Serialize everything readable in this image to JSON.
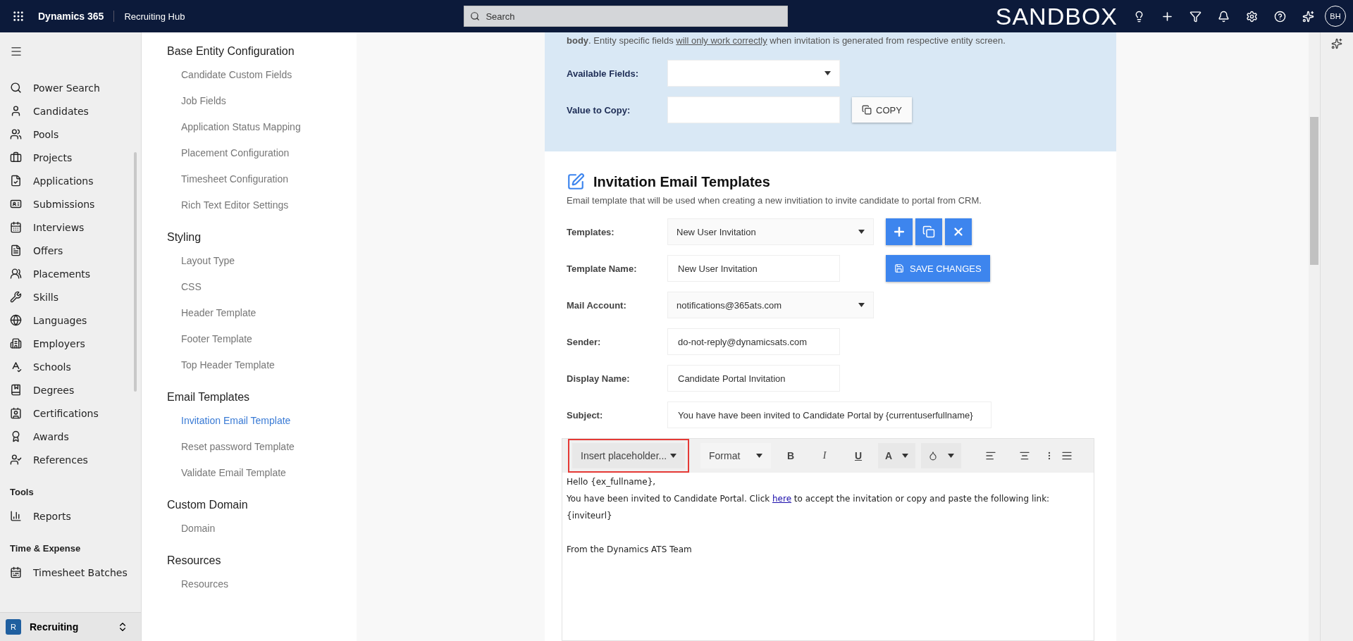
{
  "topbar": {
    "app_name": "Dynamics 365",
    "area_name": "Recruiting Hub",
    "search_placeholder": "Search",
    "environment": "SANDBOX",
    "avatar": "BH"
  },
  "nav": {
    "items": [
      {
        "label": "Power Search",
        "selected": false
      },
      {
        "label": "Candidates",
        "selected": false
      },
      {
        "label": "Pools",
        "selected": false
      },
      {
        "label": "Projects",
        "selected": false
      },
      {
        "label": "Applications",
        "selected": false
      },
      {
        "label": "Submissions",
        "selected": false
      },
      {
        "label": "Interviews",
        "selected": false
      },
      {
        "label": "Offers",
        "selected": false
      },
      {
        "label": "Placements",
        "selected": false
      },
      {
        "label": "Skills",
        "selected": false
      },
      {
        "label": "Languages",
        "selected": false
      },
      {
        "label": "Employers",
        "selected": false
      },
      {
        "label": "Schools",
        "selected": false
      },
      {
        "label": "Degrees",
        "selected": false
      },
      {
        "label": "Certifications",
        "selected": false
      },
      {
        "label": "Awards",
        "selected": false
      },
      {
        "label": "References",
        "selected": false
      }
    ],
    "groups": [
      {
        "title": "Tools",
        "items": [
          {
            "label": "Reports",
            "selected": false
          }
        ]
      },
      {
        "title": "Time & Expense",
        "items": [
          {
            "label": "Timesheet Batches",
            "selected": false
          }
        ]
      }
    ],
    "area_switcher": {
      "badge": "R",
      "label": "Recruiting"
    }
  },
  "settings_menu": [
    {
      "title": "Base Entity Configuration",
      "items": [
        {
          "label": "Candidate Custom Fields",
          "selected": false
        },
        {
          "label": "Job Fields",
          "selected": false
        },
        {
          "label": "Application Status Mapping",
          "selected": false
        },
        {
          "label": "Placement Configuration",
          "selected": false
        },
        {
          "label": "Timesheet Configuration",
          "selected": false
        },
        {
          "label": "Rich Text Editor Settings",
          "selected": false
        }
      ]
    },
    {
      "title": "Styling",
      "items": [
        {
          "label": "Layout Type",
          "selected": false
        },
        {
          "label": "CSS",
          "selected": false
        },
        {
          "label": "Header Template",
          "selected": false
        },
        {
          "label": "Footer Template",
          "selected": false
        },
        {
          "label": "Top Header Template",
          "selected": false
        }
      ]
    },
    {
      "title": "Email Templates",
      "items": [
        {
          "label": "Invitation Email Template",
          "selected": true
        },
        {
          "label": "Reset password Template",
          "selected": false
        },
        {
          "label": "Validate Email Template",
          "selected": false
        }
      ]
    },
    {
      "title": "Custom Domain",
      "items": [
        {
          "label": "Domain",
          "selected": false
        }
      ]
    },
    {
      "title": "Resources",
      "items": [
        {
          "label": "Resources",
          "selected": false
        }
      ]
    }
  ],
  "field_helper": {
    "note_start": "**body**. Entity specific fields ",
    "note_link": "will only work correctly",
    "note_end": " when invitation is generated from respective entity screen.",
    "available_fields_label": "Available Fields:",
    "value_to_copy_label": "Value to Copy:",
    "copy_button": "COPY"
  },
  "template_section": {
    "title": "Invitation Email Templates",
    "description": "Email template that will be used when creating a new invitiation to invite candidate to portal from CRM.",
    "fields": [
      {
        "label": "Templates:",
        "kind": "select",
        "value": "New User Invitation"
      },
      {
        "label": "Template Name:",
        "kind": "input",
        "value": "New User Invitation"
      },
      {
        "label": "Mail Account:",
        "kind": "select",
        "value": "notifications@365ats.com"
      },
      {
        "label": "Sender:",
        "kind": "input",
        "value": "do-not-reply@dynamicsats.com"
      },
      {
        "label": "Display Name:",
        "kind": "input",
        "value": "Candidate Portal Invitation"
      },
      {
        "label": "Subject:",
        "kind": "wide",
        "value": "You have have been invited to Candidate Portal by {currentuserfullname}"
      }
    ],
    "save_button": "SAVE CHANGES"
  },
  "editor": {
    "toolbar": {
      "placeholder_dropdown": "Insert placeholder...",
      "highlighted": true,
      "format_dropdown": "Format",
      "bold": "B",
      "italic": "I",
      "underline": "U",
      "font_color": "A"
    },
    "body": {
      "greeting": "Hello {ex_fullname},",
      "invite_before": "You have been invited to Candidate Portal. Click ",
      "invite_link": "here",
      "invite_after": " to accept the invitation or copy and paste the following link:",
      "url": "{inviteurl}",
      "signoff": "From the Dynamics ATS Team"
    }
  }
}
